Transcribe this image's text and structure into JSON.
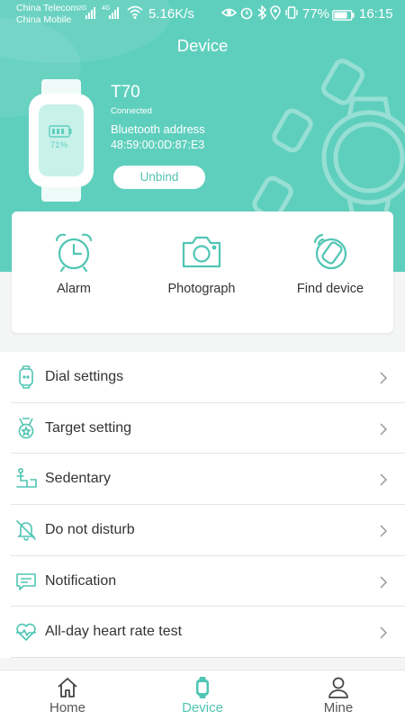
{
  "status_bar": {
    "carrier1": "China Telecom",
    "carrier2": "China Mobile",
    "net1": "2G",
    "net2": "4G",
    "speed": "5.16K/s",
    "battery": "77%",
    "time": "16:15"
  },
  "header": {
    "title": "Device",
    "device_name": "T70",
    "device_status": "Connected",
    "bt_label": "Bluetooth address",
    "bt_address": "48:59:00:0D:87:E3",
    "watch_battery": "71%",
    "unbind_label": "Unbind"
  },
  "quick_actions": {
    "alarm": "Alarm",
    "photograph": "Photograph",
    "find_device": "Find device"
  },
  "menu": {
    "items": [
      {
        "label": "Dial settings",
        "icon": "watch-dial-icon"
      },
      {
        "label": "Target setting",
        "icon": "medal-icon"
      },
      {
        "label": "Sedentary",
        "icon": "sedentary-icon"
      },
      {
        "label": "Do not disturb",
        "icon": "bell-off-icon"
      },
      {
        "label": "Notification",
        "icon": "message-icon"
      },
      {
        "label": "All-day heart rate test",
        "icon": "heart-rate-icon"
      }
    ]
  },
  "bottom_nav": {
    "home": "Home",
    "device": "Device",
    "mine": "Mine",
    "active": "Device"
  },
  "colors": {
    "accent": "#5fcfbd",
    "accent_dark": "#4fc5b3",
    "text": "#333333"
  }
}
